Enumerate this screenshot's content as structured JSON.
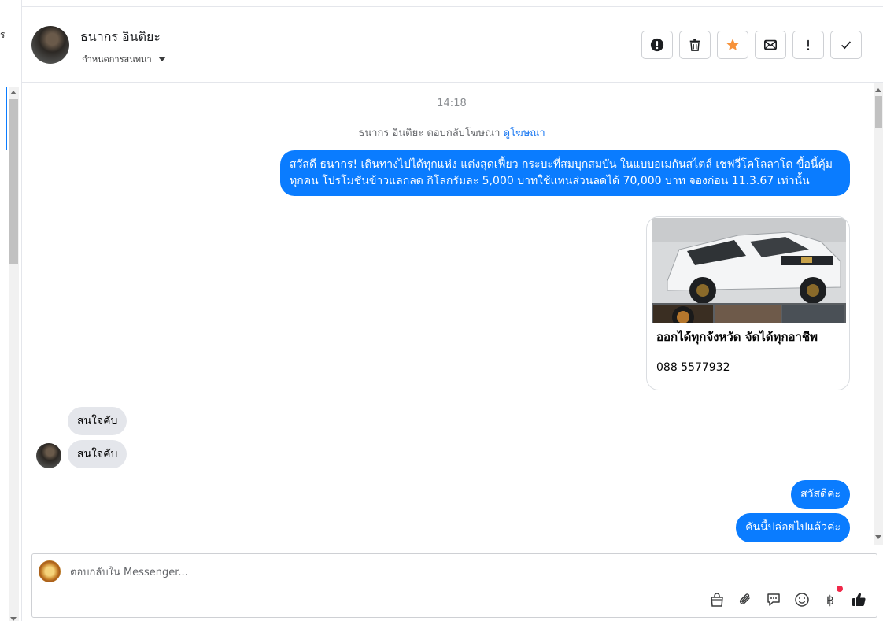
{
  "left_pane": {
    "cut_text": "ร"
  },
  "header": {
    "contact_name": "ธนากร อินติยะ",
    "assign_label": "กำหนดการสนทนา",
    "actions": [
      {
        "name": "mark-spam-button",
        "icon": "exclamation-circle-icon"
      },
      {
        "name": "delete-button",
        "icon": "trash-icon"
      },
      {
        "name": "star-button",
        "icon": "star-icon"
      },
      {
        "name": "mark-unread-button",
        "icon": "envelope-icon"
      },
      {
        "name": "follow-up-button",
        "icon": "exclamation-icon"
      },
      {
        "name": "mark-done-button",
        "icon": "check-icon"
      }
    ]
  },
  "conversation": {
    "timestamp": "14:18",
    "reply_note_prefix": "ธนากร อินติยะ ตอบกลับโฆษณา",
    "reply_note_link": "ดูโฆษณา",
    "promo_message": "สวัสดี ธนากร! เดินทางไปได้ทุกแห่ง แต่งสุดเฟี้ยว กระบะที่สมบุกสมบัน ในแบบอเมกันสไตล์ เชฟวี่โคโลลาโด ขื้อนี้คุ้มทุกคน โปรโมชั่นข้าวแลกลด กิโลกรัมละ 5,000 บาทใช้แทนส่วนลดได้ 70,000 บาท จองก่อน 11.3.67 เท่านั้น",
    "ad_card": {
      "headline": "ออกได้ทุกจังหวัด จัดได้ทุกอาชีพ",
      "phone": "088 5577932"
    },
    "incoming": [
      "สนใจคับ",
      "สนใจคับ"
    ],
    "outgoing": [
      "สวัสดีค่ะ",
      "คันนี้ปล่อยไปแล้วค่ะ"
    ]
  },
  "composer": {
    "placeholder": "ตอบกลับใน Messenger...",
    "baht_symbol": "฿",
    "tools": [
      "shop-bag-icon",
      "paperclip-icon",
      "saved-reply-icon",
      "emoji-icon",
      "baht-payment-icon",
      "thumbs-up-icon"
    ]
  },
  "colors": {
    "outgoing_bubble": "#0a7cff",
    "incoming_bubble": "#e4e6eb",
    "star_accent": "#f7923a",
    "notification_dot": "#f02849"
  }
}
